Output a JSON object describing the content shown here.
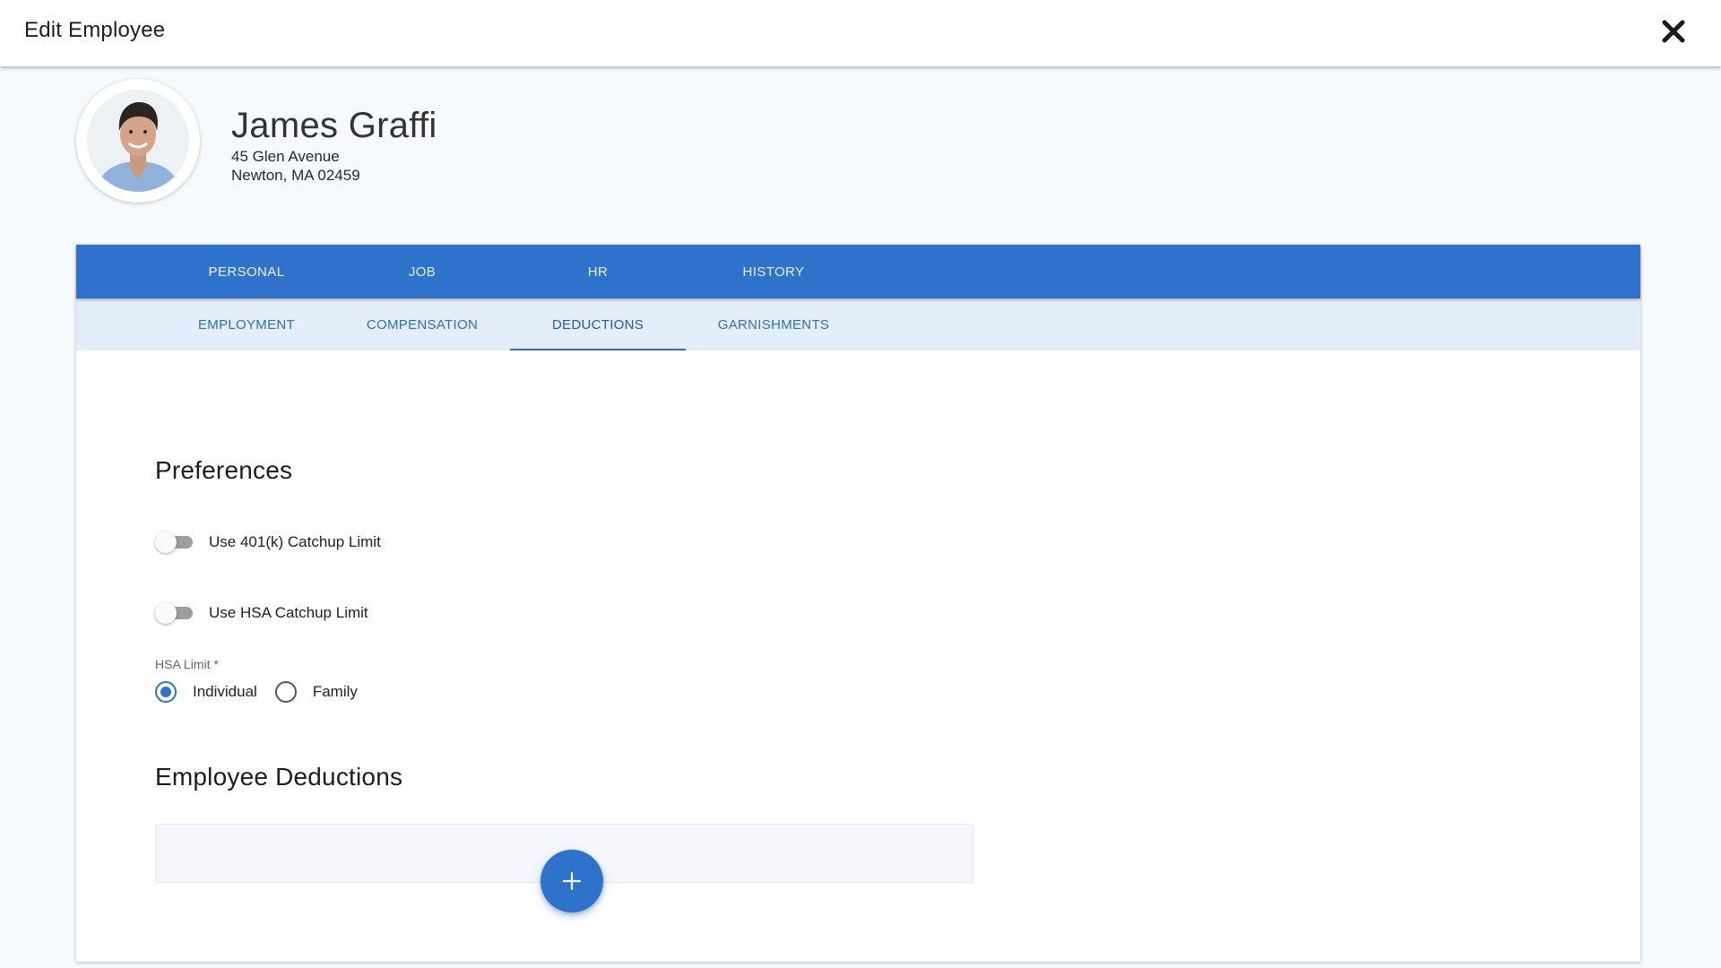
{
  "header": {
    "title": "Edit Employee",
    "close_icon": "close-icon"
  },
  "employee": {
    "name": "James Graffi",
    "address_line1": "45 Glen Avenue",
    "address_line2": "Newton, MA 02459",
    "avatar_icon": "person-photo"
  },
  "tabs": {
    "primary": [
      {
        "label": "PERSONAL"
      },
      {
        "label": "JOB"
      },
      {
        "label": "HR"
      },
      {
        "label": "HISTORY"
      }
    ],
    "secondary": [
      {
        "label": "EMPLOYMENT"
      },
      {
        "label": "COMPENSATION"
      },
      {
        "label": "DEDUCTIONS",
        "active": true
      },
      {
        "label": "GARNISHMENTS"
      }
    ]
  },
  "preferences": {
    "title": "Preferences",
    "toggles": [
      {
        "label": "Use 401(k) Catchup Limit",
        "on": false
      },
      {
        "label": "Use HSA Catchup Limit",
        "on": false
      }
    ],
    "hsa_limit": {
      "label": "HSA Limit *",
      "options": [
        {
          "label": "Individual",
          "checked": true
        },
        {
          "label": "Family",
          "checked": false
        }
      ]
    }
  },
  "deductions": {
    "title": "Employee Deductions",
    "add_icon": "plus-icon"
  },
  "colors": {
    "primary": "#2f72cc",
    "secondary_tab_bg": "#e3eefa",
    "page_bg": "#f6fafd"
  }
}
